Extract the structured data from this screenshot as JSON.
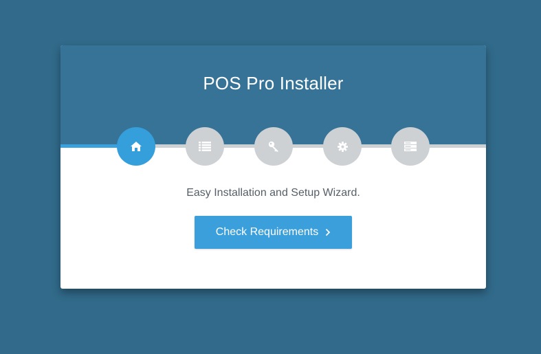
{
  "installer": {
    "title": "POS Pro Installer",
    "subtitle": "Easy Installation and Setup Wizard.",
    "primary_button_label": "Check Requirements",
    "primary_button_icon": "chevron-right-icon"
  },
  "steps": [
    {
      "icon": "home-icon",
      "active": true
    },
    {
      "icon": "list-icon",
      "active": false
    },
    {
      "icon": "key-icon",
      "active": false
    },
    {
      "icon": "gear-icon",
      "active": false
    },
    {
      "icon": "server-icon",
      "active": false
    }
  ],
  "colors": {
    "page_background": "#316a8a",
    "header_background": "#367397",
    "accent": "#359fdc",
    "inactive_step": "#cdd1d4"
  }
}
